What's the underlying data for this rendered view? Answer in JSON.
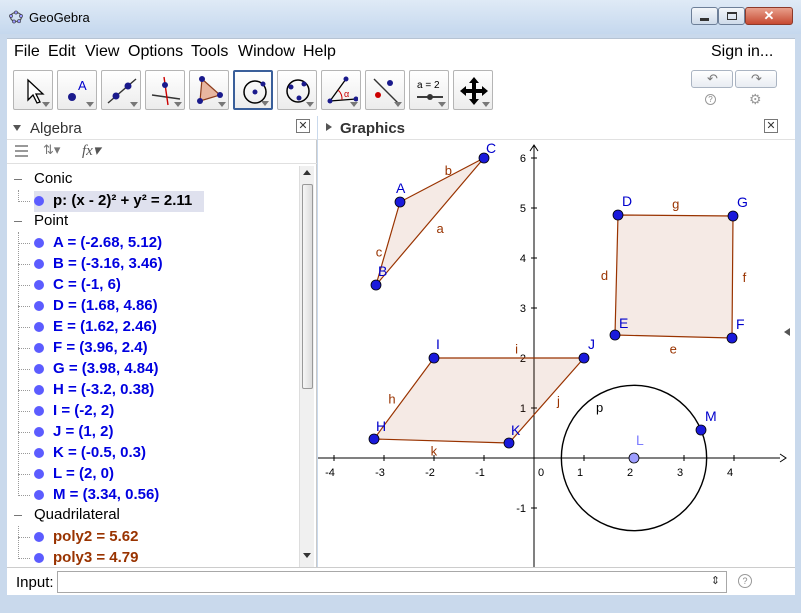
{
  "window": {
    "title": "GeoGebra"
  },
  "menu": {
    "items": [
      "File",
      "Edit",
      "View",
      "Options",
      "Tools",
      "Window",
      "Help"
    ],
    "signin": "Sign in..."
  },
  "toolbar": {
    "tools": [
      "move-tool-icon",
      "point-tool-icon",
      "line-tool-icon",
      "perpendicular-line-tool-icon",
      "polygon-tool-icon",
      "circle-tool-icon",
      "conic-tool-icon",
      "angle-tool-icon",
      "reflect-tool-icon",
      "slider-tool-icon",
      "move-graphics-view-tool-icon"
    ],
    "slider_label": "a = 2",
    "selected": "circle-tool-icon"
  },
  "algebra": {
    "title": "Algebra",
    "categories": [
      {
        "name": "Conic",
        "items": [
          {
            "text": "p: (x - 2)² + y² = 2.11",
            "color": "#000000",
            "dot": "#5c5cff",
            "highlight": true
          }
        ]
      },
      {
        "name": "Point",
        "items": [
          {
            "text": "A = (-2.68, 5.12)",
            "color": "#0000e0",
            "dot": "#5c5cff"
          },
          {
            "text": "B = (-3.16, 3.46)",
            "color": "#0000e0",
            "dot": "#5c5cff"
          },
          {
            "text": "C = (-1, 6)",
            "color": "#0000e0",
            "dot": "#5c5cff"
          },
          {
            "text": "D = (1.68, 4.86)",
            "color": "#0000e0",
            "dot": "#5c5cff"
          },
          {
            "text": "E = (1.62, 2.46)",
            "color": "#0000e0",
            "dot": "#5c5cff"
          },
          {
            "text": "F = (3.96, 2.4)",
            "color": "#0000e0",
            "dot": "#5c5cff"
          },
          {
            "text": "G = (3.98, 4.84)",
            "color": "#0000e0",
            "dot": "#5c5cff"
          },
          {
            "text": "H = (-3.2, 0.38)",
            "color": "#0000e0",
            "dot": "#5c5cff"
          },
          {
            "text": "I = (-2, 2)",
            "color": "#0000e0",
            "dot": "#5c5cff"
          },
          {
            "text": "J = (1, 2)",
            "color": "#0000e0",
            "dot": "#5c5cff"
          },
          {
            "text": "K = (-0.5, 0.3)",
            "color": "#0000e0",
            "dot": "#5c5cff"
          },
          {
            "text": "L = (2, 0)",
            "color": "#0000e0",
            "dot": "#5c5cff"
          },
          {
            "text": "M = (3.34, 0.56)",
            "color": "#0000e0",
            "dot": "#5c5cff"
          }
        ]
      },
      {
        "name": "Quadrilateral",
        "items": [
          {
            "text": "poly2 = 5.62",
            "color": "#993300",
            "dot": "#5c5cff"
          },
          {
            "text": "poly3 = 4.79",
            "color": "#993300",
            "dot": "#5c5cff"
          }
        ]
      }
    ]
  },
  "graphics": {
    "title": "Graphics",
    "x_ticks": [
      "-4",
      "-3",
      "-2",
      "-1",
      "0",
      "1",
      "2",
      "3",
      "4"
    ],
    "y_ticks": [
      "6",
      "5",
      "4",
      "3",
      "2",
      "1",
      "-1"
    ],
    "points": [
      {
        "label": "A",
        "x": -2.68,
        "y": 5.12
      },
      {
        "label": "B",
        "x": -3.16,
        "y": 3.46
      },
      {
        "label": "C",
        "x": -1,
        "y": 6
      },
      {
        "label": "D",
        "x": 1.68,
        "y": 4.86
      },
      {
        "label": "E",
        "x": 1.62,
        "y": 2.46
      },
      {
        "label": "F",
        "x": 3.96,
        "y": 2.4
      },
      {
        "label": "G",
        "x": 3.98,
        "y": 4.84
      },
      {
        "label": "H",
        "x": -3.2,
        "y": 0.38
      },
      {
        "label": "I",
        "x": -2,
        "y": 2
      },
      {
        "label": "J",
        "x": 1,
        "y": 2
      },
      {
        "label": "K",
        "x": -0.5,
        "y": 0.3
      },
      {
        "label": "L",
        "x": 2,
        "y": 0,
        "light": true
      },
      {
        "label": "M",
        "x": 3.34,
        "y": 0.56
      }
    ],
    "polygons": [
      {
        "name": "triangle",
        "vertices": [
          "A",
          "B",
          "C"
        ],
        "edges": [
          [
            "c",
            "A",
            "B"
          ],
          [
            "a",
            "B",
            "C"
          ],
          [
            "b",
            "C",
            "A"
          ]
        ]
      },
      {
        "name": "poly2",
        "vertices": [
          "D",
          "E",
          "F",
          "G"
        ],
        "edges": [
          [
            "d",
            "D",
            "E"
          ],
          [
            "e",
            "E",
            "F"
          ],
          [
            "f",
            "F",
            "G"
          ],
          [
            "g",
            "G",
            "D"
          ]
        ]
      },
      {
        "name": "poly3",
        "vertices": [
          "H",
          "K",
          "J",
          "I"
        ],
        "edges": [
          [
            "k",
            "H",
            "K"
          ],
          [
            "j",
            "K",
            "J"
          ],
          [
            "i",
            "J",
            "I"
          ],
          [
            "h",
            "I",
            "H"
          ]
        ]
      }
    ],
    "circle": {
      "label": "p",
      "cx": 2,
      "cy": 0,
      "r": 1.453
    }
  },
  "input": {
    "label": "Input:",
    "value": ""
  }
}
